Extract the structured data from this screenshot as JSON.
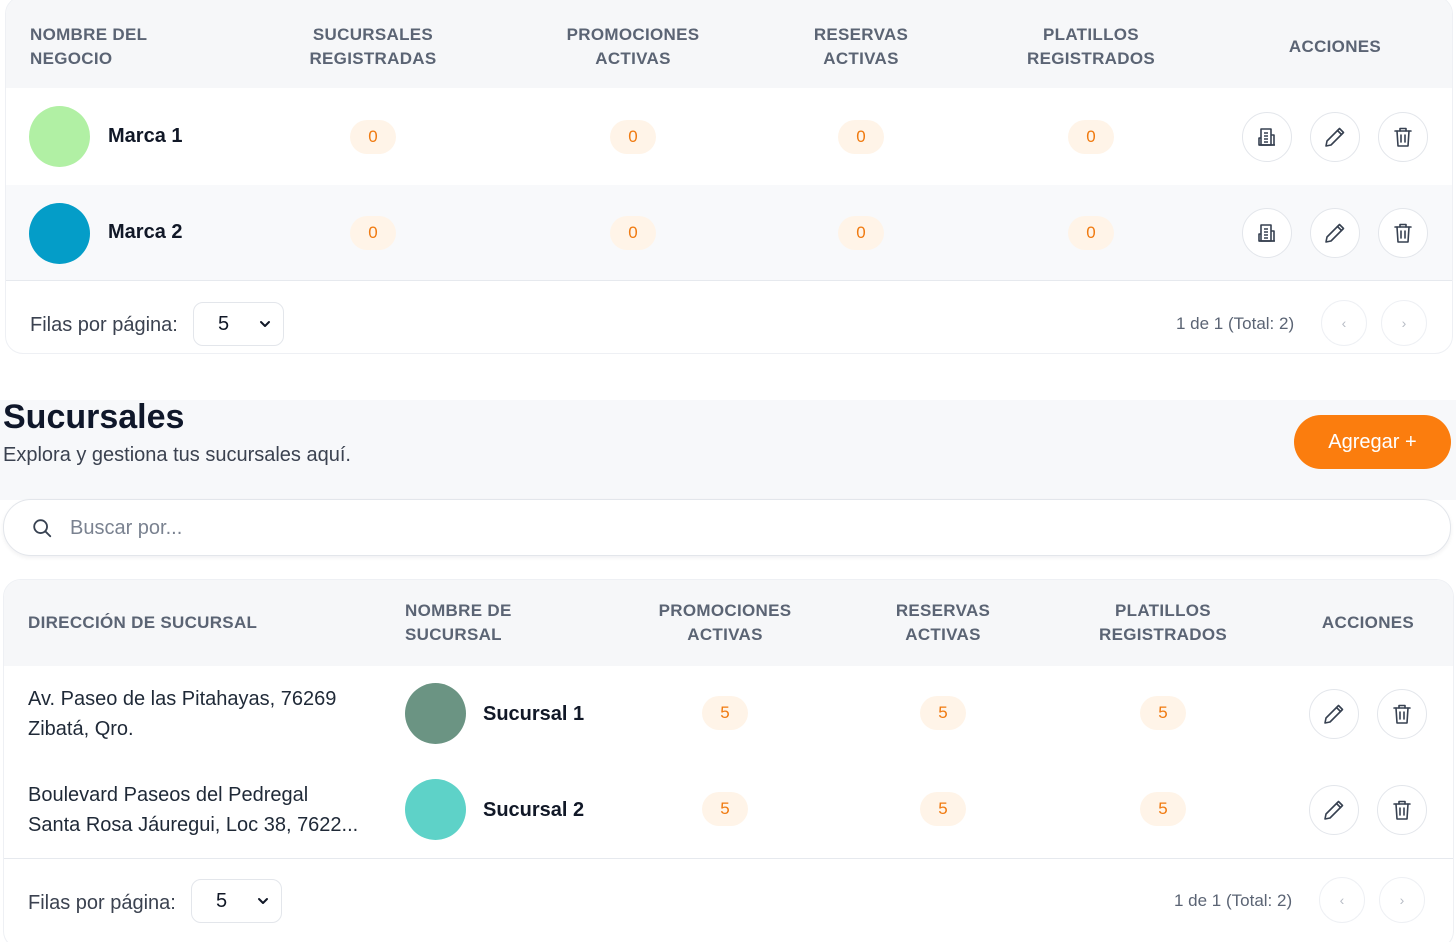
{
  "brands_table": {
    "columns": [
      "NOMBRE DEL\nNEGOCIO",
      "SUCURSALES\nREGISTRADAS",
      "PROMOCIONES\nACTIVAS",
      "RESERVAS\nACTIVAS",
      "PLATILLOS\nREGISTRADOS",
      "ACCIONES"
    ],
    "rows": [
      {
        "name": "Marca 1",
        "avatar_color": "#b1f0a4",
        "branches": "0",
        "promotions": "0",
        "reservations": "0",
        "dishes": "0"
      },
      {
        "name": "Marca 2",
        "avatar_color": "#049dc8",
        "branches": "0",
        "promotions": "0",
        "reservations": "0",
        "dishes": "0"
      }
    ],
    "footer": {
      "rows_per_page_label": "Filas por página:",
      "rows_per_page_value": "5",
      "page_info": "1 de 1 (Total: 2)"
    }
  },
  "branches_section": {
    "title": "Sucursales",
    "subtitle": "Explora y gestiona tus sucursales aquí.",
    "add_button": "Agregar +",
    "search_placeholder": "Buscar por...",
    "accent_color": "#fb7d0e"
  },
  "branches_table": {
    "columns": [
      "DIRECCIÓN DE SUCURSAL",
      "NOMBRE DE\nSUCURSAL",
      "PROMOCIONES\nACTIVAS",
      "RESERVAS\nACTIVAS",
      "PLATILLOS\nREGISTRADOS",
      "ACCIONES"
    ],
    "rows": [
      {
        "address": "Av. Paseo de las Pitahayas, 76269\nZibatá, Qro.",
        "name": "Sucursal 1",
        "avatar_color": "#6b9483",
        "promotions": "5",
        "reservations": "5",
        "dishes": "5"
      },
      {
        "address": "Boulevard Paseos del Pedregal\nSanta Rosa Jáuregui, Loc 38, 7622...",
        "name": "Sucursal 2",
        "avatar_color": "#5ed2c8",
        "promotions": "5",
        "reservations": "5",
        "dishes": "5"
      }
    ],
    "footer": {
      "rows_per_page_label": "Filas por página:",
      "rows_per_page_value": "5",
      "page_info": "1 de 1 (Total: 2)"
    }
  },
  "icons": {
    "branches": "building-icon",
    "edit": "pencil-icon",
    "delete": "trash-icon",
    "search": "search-icon",
    "select": "chevron-down-icon",
    "prev": "chevron-left-icon",
    "next": "chevron-right-icon"
  }
}
